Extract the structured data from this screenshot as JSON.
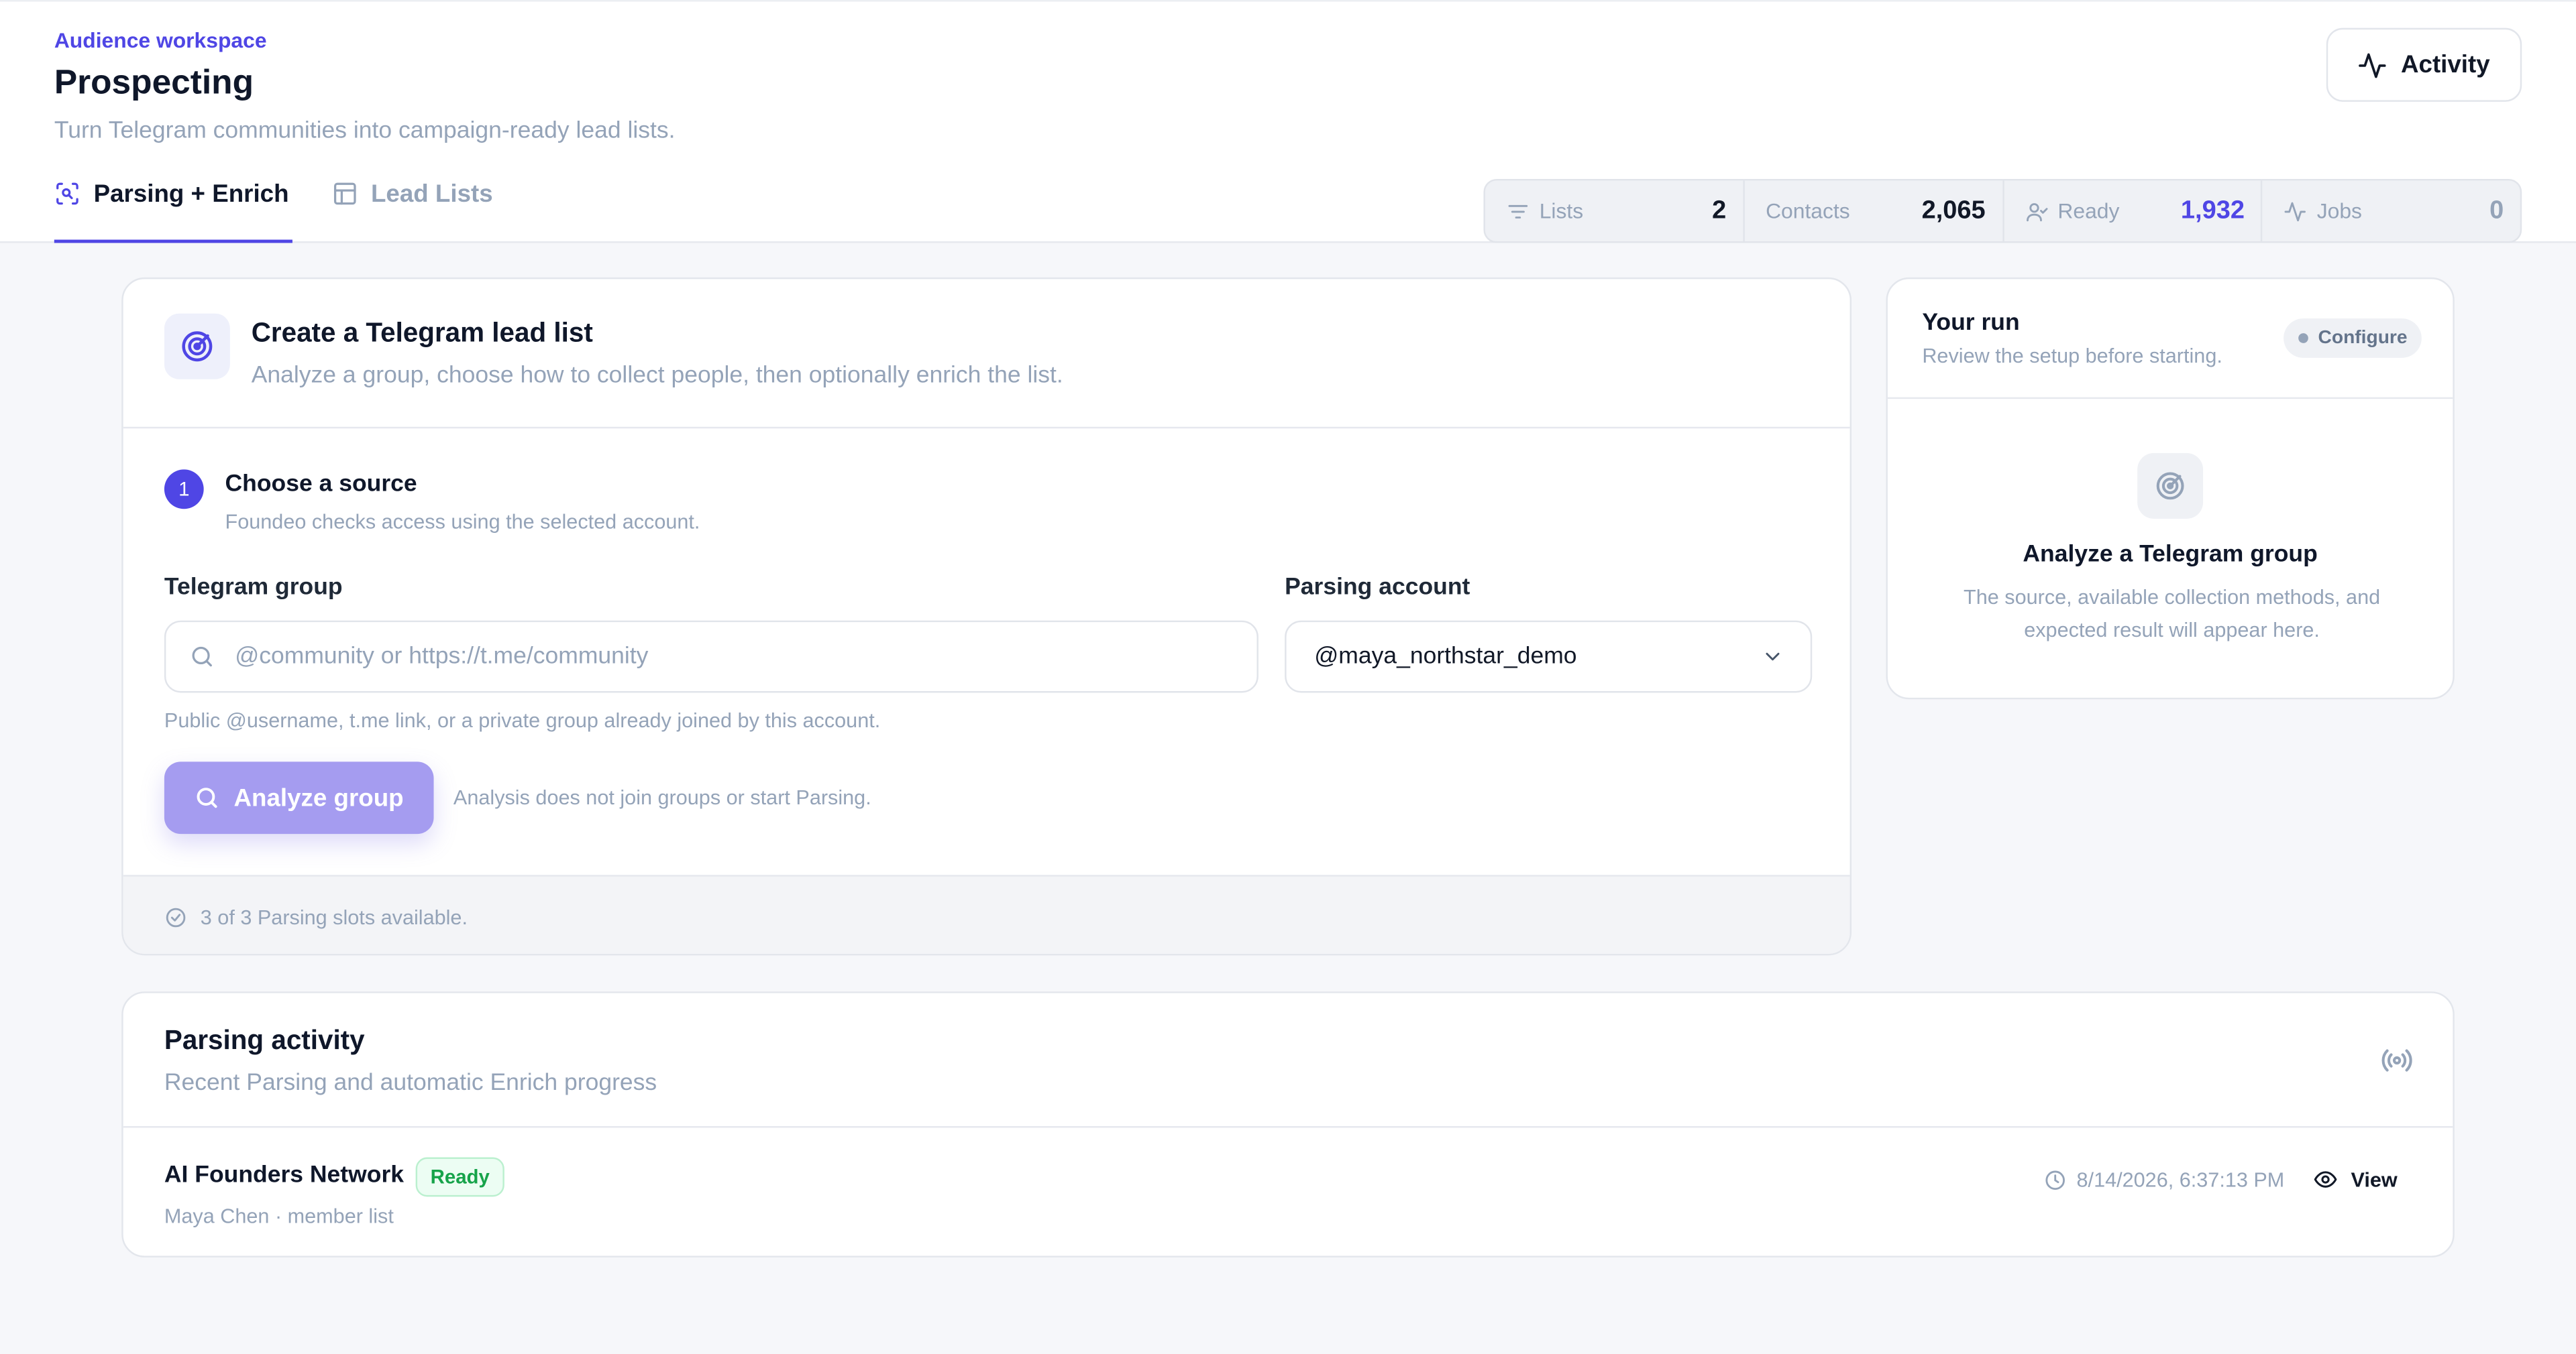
{
  "header": {
    "eyebrow": "Audience workspace",
    "title": "Prospecting",
    "subtitle": "Turn Telegram communities into campaign-ready lead lists.",
    "activity_label": "Activity"
  },
  "tabs": [
    {
      "label": "Parsing + Enrich",
      "active": true
    },
    {
      "label": "Lead Lists",
      "active": false
    }
  ],
  "stats": [
    {
      "label": "Lists",
      "value": "2"
    },
    {
      "label": "Contacts",
      "value": "2,065"
    },
    {
      "label": "Ready",
      "value": "1,932"
    },
    {
      "label": "Jobs",
      "value": "0"
    }
  ],
  "create": {
    "title": "Create a Telegram lead list",
    "subtitle": "Analyze a group, choose how to collect people, then optionally enrich the list.",
    "step_number": "1",
    "step_title": "Choose a source",
    "step_subtitle": "Foundeo checks access using the selected account.",
    "group_label": "Telegram group",
    "group_placeholder": "@community or https://t.me/community",
    "group_value": "",
    "account_label": "Parsing account",
    "account_value": "@maya_northstar_demo",
    "hint": "Public @username, t.me link, or a private group already joined by this account.",
    "analyze_label": "Analyze group",
    "analyze_note": "Analysis does not join groups or start Parsing.",
    "slots": "3 of 3 Parsing slots available."
  },
  "run": {
    "title": "Your run",
    "subtitle": "Review the setup before starting.",
    "configure": "Configure",
    "empty_title": "Analyze a Telegram group",
    "empty_subtitle": "The source, available collection methods, and expected result will appear here."
  },
  "activity": {
    "title": "Parsing activity",
    "subtitle": "Recent Parsing and automatic Enrich progress",
    "rows": [
      {
        "name": "AI Founders Network",
        "status": "Ready",
        "meta": "Maya Chen · member list",
        "time": "8/14/2026, 6:37:13 PM",
        "action": "View"
      }
    ]
  },
  "colors": {
    "accent": "#4f46e5",
    "analyze_button": "#a59cf0",
    "ready_text": "#16a34a",
    "background": "#f6f7fa"
  }
}
